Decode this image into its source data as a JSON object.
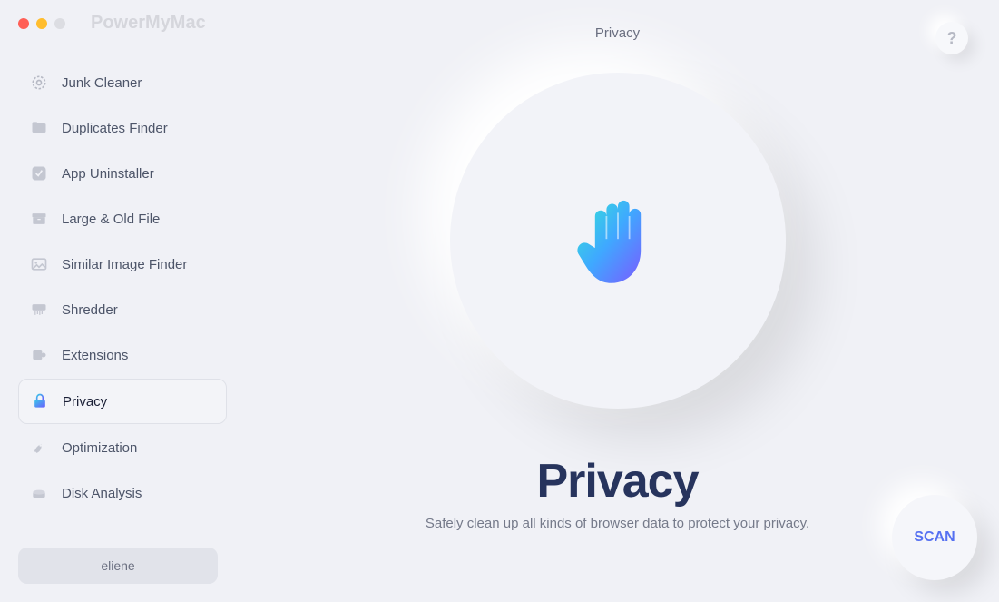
{
  "app": {
    "title": "PowerMyMac",
    "user": "eliene"
  },
  "header": {
    "section": "Privacy",
    "help": "?"
  },
  "sidebar": {
    "items": [
      {
        "label": "Junk Cleaner"
      },
      {
        "label": "Duplicates Finder"
      },
      {
        "label": "App Uninstaller"
      },
      {
        "label": "Large & Old File"
      },
      {
        "label": "Similar Image Finder"
      },
      {
        "label": "Shredder"
      },
      {
        "label": "Extensions"
      },
      {
        "label": "Privacy"
      },
      {
        "label": "Optimization"
      },
      {
        "label": "Disk Analysis"
      }
    ]
  },
  "main": {
    "title": "Privacy",
    "subtitle": "Safely clean up all kinds of browser data to protect your privacy.",
    "scan_label": "SCAN"
  }
}
